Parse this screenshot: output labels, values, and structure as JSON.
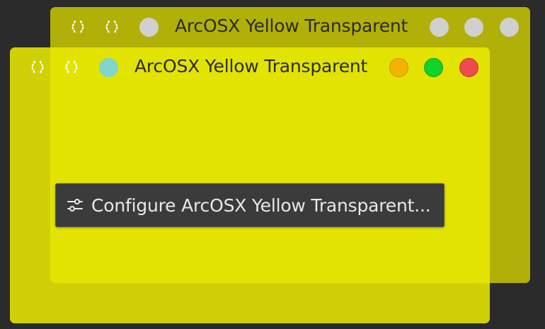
{
  "back_window": {
    "title": "ArcOSX Yellow Transparent",
    "left_icons": [
      "move-icon",
      "move-icon"
    ],
    "colors": {
      "left_dot": "#d0d0d0",
      "buttons": [
        "#d0d0d0",
        "#d0d0d0",
        "#d0d0d0"
      ]
    }
  },
  "front_window": {
    "title": "ArcOSX Yellow Transparent",
    "left_icons": [
      "move-icon",
      "move-icon"
    ],
    "colors": {
      "left_dot": "#7fd6c9",
      "minimize": "#f2b400",
      "maximize": "#12d12a",
      "close": "#ef4b4f"
    }
  },
  "context_button": {
    "label": "Configure ArcOSX Yellow Transparent...",
    "icon": "sliders-icon"
  }
}
